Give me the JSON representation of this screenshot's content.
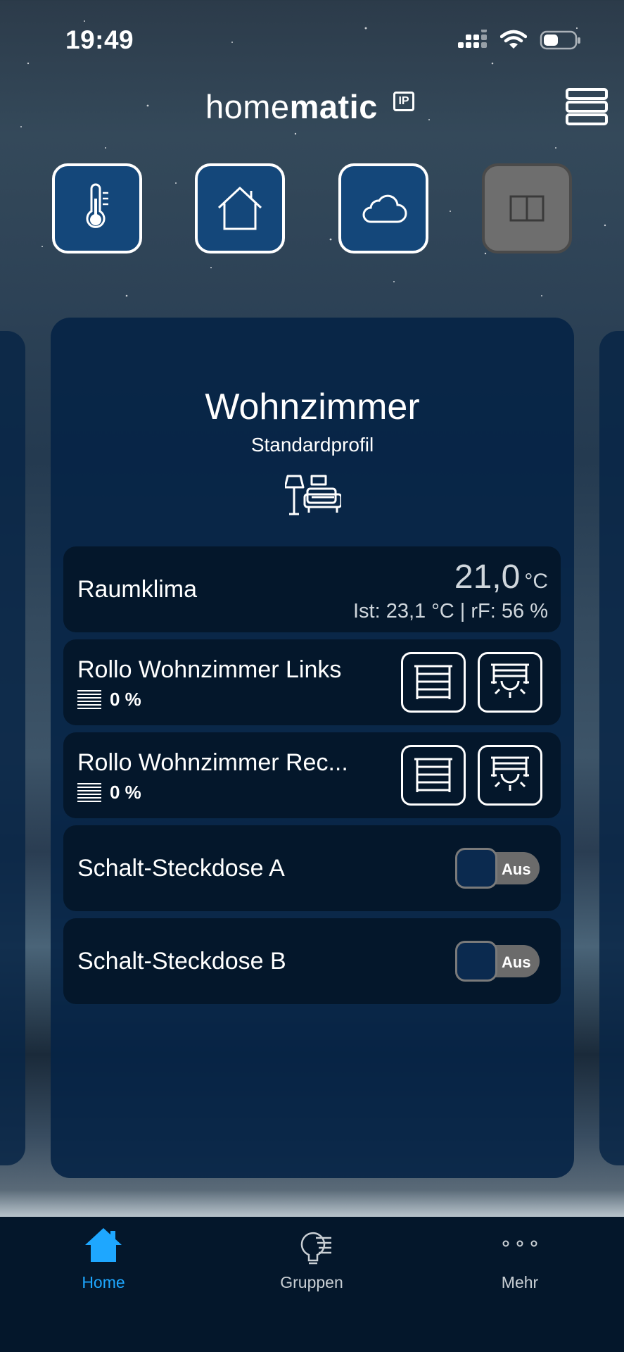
{
  "status_bar": {
    "time": "19:49",
    "icons": [
      "signal-icon",
      "wifi-icon",
      "battery-icon"
    ]
  },
  "header": {
    "brand_part1": "home",
    "brand_part2": "matic",
    "brand_badge": "IP",
    "menu_icon": "list-menu-icon"
  },
  "quick_tiles": [
    {
      "name": "climate",
      "icon": "thermometer-icon"
    },
    {
      "name": "home",
      "icon": "house-icon"
    },
    {
      "name": "weather",
      "icon": "cloud-icon"
    },
    {
      "name": "window",
      "icon": "window-icon",
      "disabled": true
    }
  ],
  "room": {
    "title": "Wohnzimmer",
    "profile": "Standardprofil",
    "icon": "living-room-icon"
  },
  "devices": {
    "climate": {
      "label": "Raumklima",
      "set_temp": "21,0",
      "unit": "°C",
      "status": "Ist: 23,1 °C | rF: 56 %"
    },
    "shutter_left": {
      "label": "Rollo Wohnzimmer Links",
      "value": "0 %"
    },
    "shutter_right": {
      "label": "Rollo Wohnzimmer Rec...",
      "value": "0 %"
    },
    "socket_a": {
      "label": "Schalt-Steckdose A",
      "state": "Aus"
    },
    "socket_b": {
      "label": "Schalt-Steckdose B",
      "state": "Aus"
    }
  },
  "bottom_nav": {
    "items": [
      {
        "label": "Home",
        "icon": "home-icon",
        "active": true
      },
      {
        "label": "Gruppen",
        "icon": "groups-bulb-icon",
        "active": false
      },
      {
        "label": "Mehr",
        "icon": "more-dots-icon",
        "active": false
      }
    ]
  },
  "colors": {
    "accent": "#1ea7ff",
    "tile_blue": "#14477a",
    "card_bg": "#062446",
    "row_bg": "#04172b",
    "toggle_off": "#6b6b6b"
  }
}
